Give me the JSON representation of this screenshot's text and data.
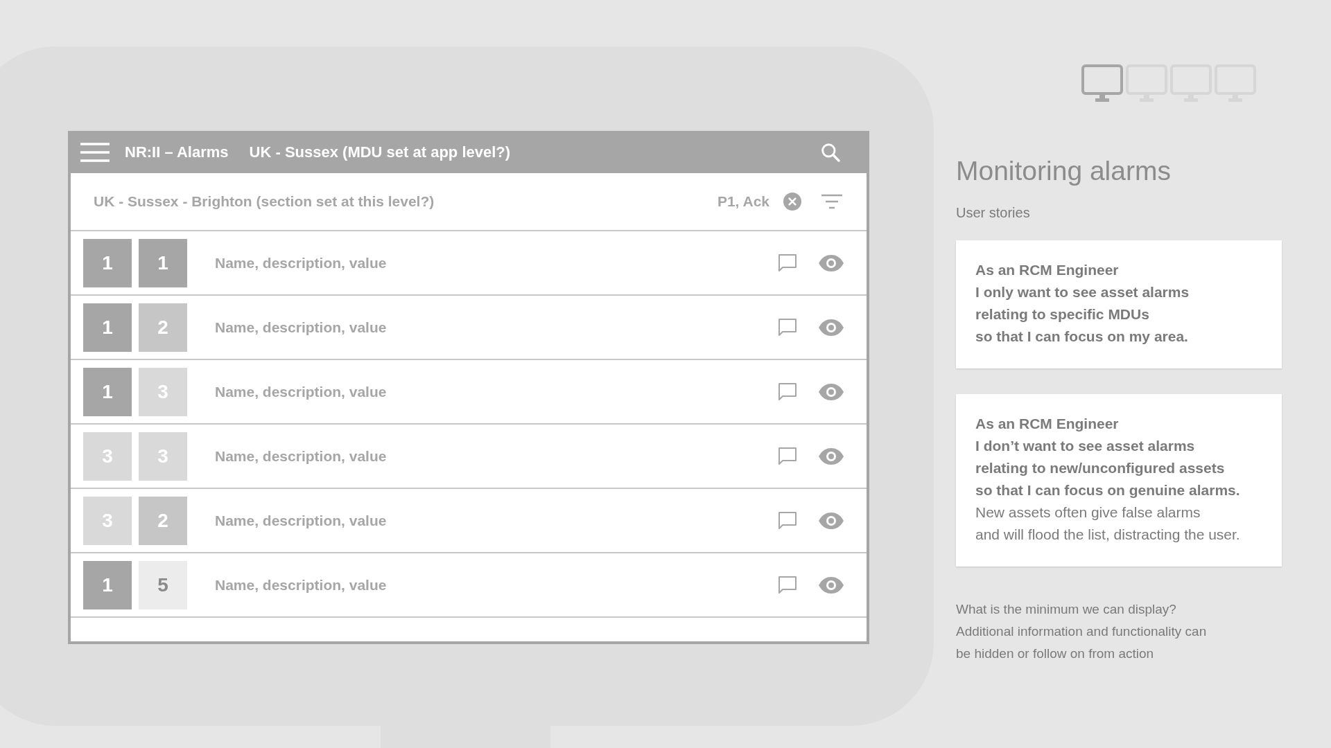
{
  "app_bar": {
    "title": "NR:II – Alarms",
    "subtitle": "UK - Sussex (MDU set at app level?)"
  },
  "filter_bar": {
    "location": "UK - Sussex - Brighton (section set at this level?)",
    "filter": "P1, Ack"
  },
  "alarms": [
    {
      "badges": [
        {
          "text": "1",
          "color": "#a6a6a6"
        },
        {
          "text": "1",
          "color": "#a6a6a6"
        }
      ],
      "text": "Name, description, value"
    },
    {
      "badges": [
        {
          "text": "1",
          "color": "#a6a6a6"
        },
        {
          "text": "2",
          "color": "#c6c6c6"
        }
      ],
      "text": "Name, description, value"
    },
    {
      "badges": [
        {
          "text": "1",
          "color": "#a6a6a6"
        },
        {
          "text": "3",
          "color": "#d9d9d9"
        }
      ],
      "text": "Name, description, value"
    },
    {
      "badges": [
        {
          "text": "3",
          "color": "#d9d9d9"
        },
        {
          "text": "3",
          "color": "#d9d9d9"
        }
      ],
      "text": "Name, description, value"
    },
    {
      "badges": [
        {
          "text": "3",
          "color": "#d9d9d9"
        },
        {
          "text": "2",
          "color": "#c6c6c6"
        }
      ],
      "text": "Name, description, value"
    },
    {
      "badges": [
        {
          "text": "1",
          "color": "#a6a6a6"
        },
        {
          "text": "5",
          "color": "#ececec"
        }
      ],
      "text": "Name, description, value"
    }
  ],
  "device_switcher": [
    {
      "selected": true
    },
    {
      "selected": false
    },
    {
      "selected": false
    },
    {
      "selected": false
    }
  ],
  "heading": "Monitoring alarms",
  "subheading": "User stories",
  "stories": [
    {
      "story": "As an RCM Engineer\nI only want to see asset alarms\nrelating to specific MDUs\nso that I can focus on my area."
    },
    {
      "story": "As an RCM Engineer\nI don’t want to see asset alarms\nrelating to new/unconfigured assets\nso that I can focus on genuine alarms.",
      "note": "New assets often give false alarms\nand will flood the list, distracting the user."
    }
  ],
  "footer_note": "What is the minimum we can display?\nAdditional information and functionality can\nbe hidden or follow on from action"
}
